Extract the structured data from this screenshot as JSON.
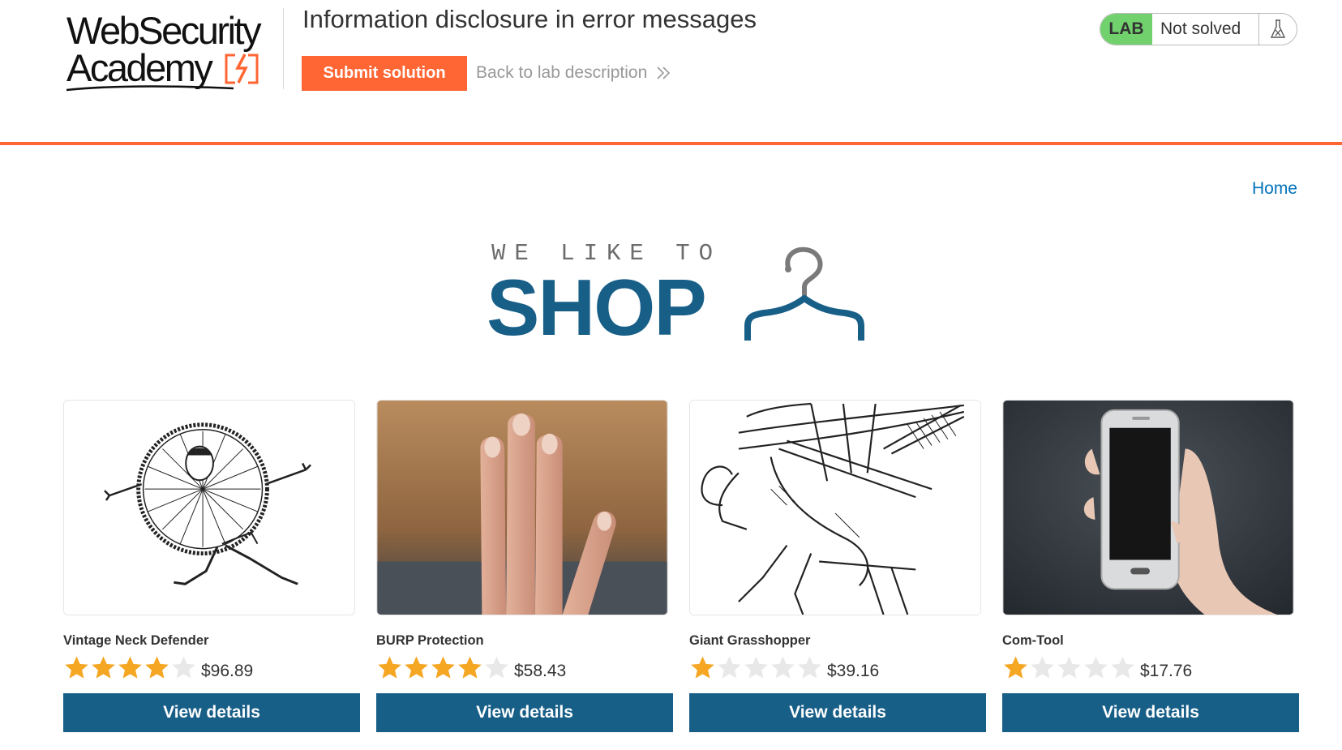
{
  "header": {
    "logo_line1": "WebSecurity",
    "logo_line2": "Academy",
    "lab_title": "Information disclosure in error messages",
    "submit_label": "Submit solution",
    "back_label": "Back to lab description",
    "lab_badge": "LAB",
    "lab_status": "Not solved"
  },
  "nav": {
    "home_label": "Home"
  },
  "banner": {
    "top_text": "WE LIKE TO",
    "main_text": "SHOP"
  },
  "colors": {
    "accent_orange": "#ff6633",
    "primary_blue": "#185f88",
    "lab_green": "#70d16d",
    "link_blue": "#0071bc",
    "star_gold": "#f5a623"
  },
  "products": [
    {
      "name": "Vintage Neck Defender",
      "rating": 4,
      "price": "$96.89",
      "button": "View details",
      "image": "vintage-neck-defender-drawing"
    },
    {
      "name": "BURP Protection",
      "rating": 4,
      "price": "$58.43",
      "button": "View details",
      "image": "beard-hand-photo"
    },
    {
      "name": "Giant Grasshopper",
      "rating": 1,
      "price": "$39.16",
      "button": "View details",
      "image": "grasshopper-rider-drawing"
    },
    {
      "name": "Com-Tool",
      "rating": 1,
      "price": "$17.76",
      "button": "View details",
      "image": "hand-holding-phone-photo"
    }
  ]
}
